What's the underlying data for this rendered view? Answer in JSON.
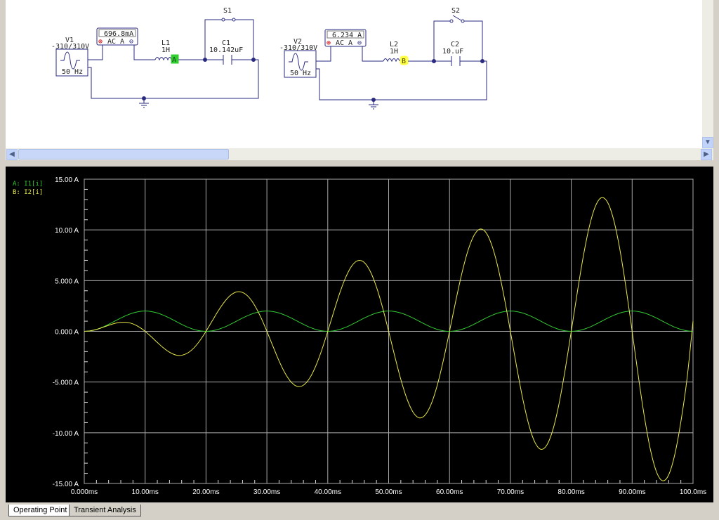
{
  "schematic": {
    "circuit1": {
      "source_name": "V1",
      "source_value": "-310/310V",
      "source_freq": "50 Hz",
      "meter_reading": "696.8mA",
      "meter_mode": "AC A",
      "inductor_name": "L1",
      "inductor_value": "1H",
      "probe": "A",
      "probe_color": "#33cc33",
      "switch_name": "S1",
      "switch_state": "closed",
      "cap_name": "C1",
      "cap_value": "10.142uF"
    },
    "circuit2": {
      "source_name": "V2",
      "source_value": "-310/310V",
      "source_freq": "50 Hz",
      "meter_reading": "6.234 A",
      "meter_mode": "AC A",
      "inductor_name": "L2",
      "inductor_value": "1H",
      "probe": "B",
      "probe_color": "#ffff44",
      "switch_name": "S2",
      "switch_state": "open",
      "cap_name": "C2",
      "cap_value": "10.uF"
    }
  },
  "tabs": [
    {
      "label": "Operating Point",
      "active": true
    },
    {
      "label": "Transient Analysis",
      "active": false
    }
  ],
  "chart_data": {
    "type": "line",
    "xlabel": "",
    "ylabel": "",
    "xlim": [
      0,
      100
    ],
    "ylim": [
      -15,
      15
    ],
    "x_ticks": [
      "0.000ms",
      "10.00ms",
      "20.00ms",
      "30.00ms",
      "40.00ms",
      "50.00ms",
      "60.00ms",
      "70.00ms",
      "80.00ms",
      "90.00ms",
      "100.0ms"
    ],
    "y_ticks": [
      "15.00 A",
      "10.00 A",
      "5.000 A",
      "0.000 A",
      "-5.000 A",
      "-10.00 A",
      "-15.00 A"
    ],
    "grid": true,
    "legend_placement": "top-left",
    "x_step_ms": 1,
    "series": [
      {
        "name": "A: I1[i]",
        "color": "#33cc33",
        "values": [
          0,
          0.05,
          0.19,
          0.41,
          0.69,
          1,
          1.31,
          1.59,
          1.81,
          1.95,
          2,
          1.95,
          1.81,
          1.59,
          1.31,
          1,
          0.69,
          0.41,
          0.19,
          0.05,
          0,
          0.05,
          0.19,
          0.41,
          0.69,
          1,
          1.31,
          1.59,
          1.81,
          1.95,
          2,
          1.95,
          1.81,
          1.59,
          1.31,
          1,
          0.69,
          0.41,
          0.19,
          0.05,
          0,
          0.05,
          0.19,
          0.41,
          0.69,
          1,
          1.31,
          1.59,
          1.81,
          1.95,
          2,
          1.95,
          1.81,
          1.59,
          1.31,
          1,
          0.69,
          0.41,
          0.19,
          0.05,
          0,
          0.05,
          0.19,
          0.41,
          0.69,
          1,
          1.31,
          1.59,
          1.81,
          1.95,
          2,
          1.95,
          1.81,
          1.59,
          1.31,
          1,
          0.69,
          0.41,
          0.19,
          0.05,
          0,
          0.05,
          0.19,
          0.41,
          0.69,
          1,
          1.31,
          1.59,
          1.81,
          1.95,
          2,
          1.95,
          1.81,
          1.59,
          1.31,
          1,
          0.69,
          0.41,
          0.19,
          0.05,
          0
        ]
      },
      {
        "name": "B: I2[i]",
        "color": "#e8e84a",
        "values": [
          0,
          0.05,
          0.18,
          0.38,
          0.59,
          0.78,
          0.88,
          0.88,
          0.73,
          0.43,
          0,
          -0.53,
          -1.09,
          -1.63,
          -2.06,
          -2.33,
          -2.36,
          -2.13,
          -1.64,
          -0.91,
          0,
          1.01,
          2.01,
          2.88,
          3.54,
          3.88,
          3.83,
          3.39,
          2.55,
          1.39,
          0,
          -1.48,
          -2.92,
          -4.14,
          -5.01,
          -5.43,
          -5.31,
          -4.64,
          -3.46,
          -1.87,
          0,
          1.96,
          3.83,
          5.39,
          6.49,
          6.98,
          6.78,
          5.89,
          4.37,
          2.35,
          0,
          -2.44,
          -4.74,
          -6.65,
          -7.96,
          -8.53,
          -8.25,
          -7.15,
          -5.29,
          -2.83,
          0,
          2.92,
          5.65,
          7.9,
          9.43,
          10.08,
          9.73,
          8.4,
          6.2,
          3.3,
          0,
          -3.4,
          -6.56,
          -9.15,
          -10.91,
          -11.63,
          -11.2,
          -9.66,
          -7.11,
          -3.78,
          0,
          3.88,
          7.47,
          10.41,
          12.38,
          13.18,
          12.68,
          10.91,
          8.02,
          4.26,
          0,
          -4.36,
          -8.38,
          -11.66,
          -13.86,
          -14.73,
          -14.15,
          -12.16,
          -8.93,
          -4.74,
          1.0
        ]
      }
    ]
  }
}
